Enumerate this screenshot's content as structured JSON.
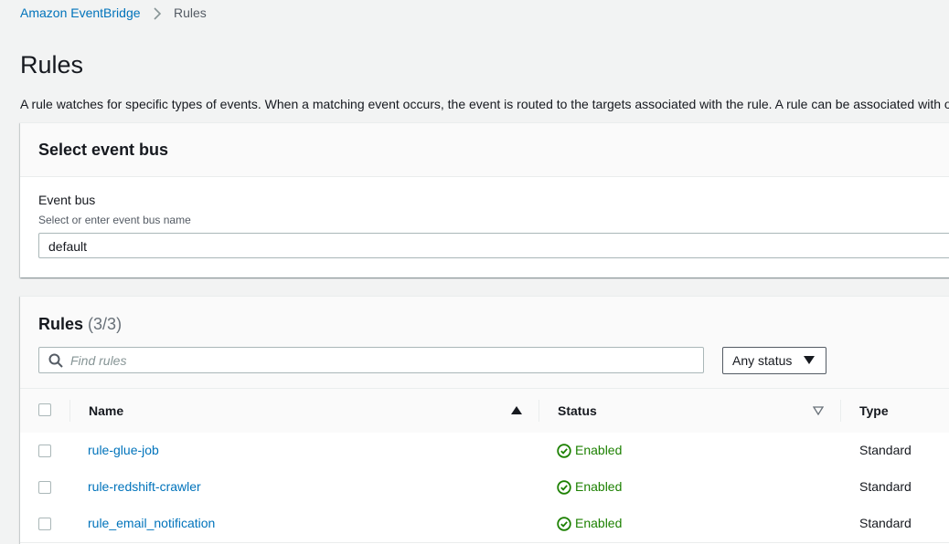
{
  "breadcrumb": {
    "root": "Amazon EventBridge",
    "current": "Rules"
  },
  "page": {
    "title": "Rules",
    "description": "A rule watches for specific types of events. When a matching event occurs, the event is routed to the targets associated with the rule. A rule can be associated with one or more targets."
  },
  "event_bus_panel": {
    "title": "Select event bus",
    "field_label": "Event bus",
    "field_description": "Select or enter event bus name",
    "value": "default"
  },
  "rules_panel": {
    "title": "Rules",
    "count": "(3/3)",
    "search_placeholder": "Find rules",
    "status_filter": "Any status",
    "columns": {
      "name": "Name",
      "status": "Status",
      "type": "Type"
    },
    "rows": [
      {
        "name": "rule-glue-job",
        "status": "Enabled",
        "type": "Standard"
      },
      {
        "name": "rule-redshift-crawler",
        "status": "Enabled",
        "type": "Standard"
      },
      {
        "name": "rule_email_notification",
        "status": "Enabled",
        "type": "Standard"
      }
    ]
  },
  "colors": {
    "link": "#0073bb",
    "success": "#1d8102",
    "text": "#16191f",
    "background": "#f2f3f3"
  },
  "icons": {
    "breadcrumb_separator": "chevron-right-icon",
    "search": "search-icon",
    "dropdown": "caret-down-icon",
    "sort_asc": "sort-ascending-icon",
    "sort_none": "sort-icon",
    "status": "check-circle-icon"
  }
}
